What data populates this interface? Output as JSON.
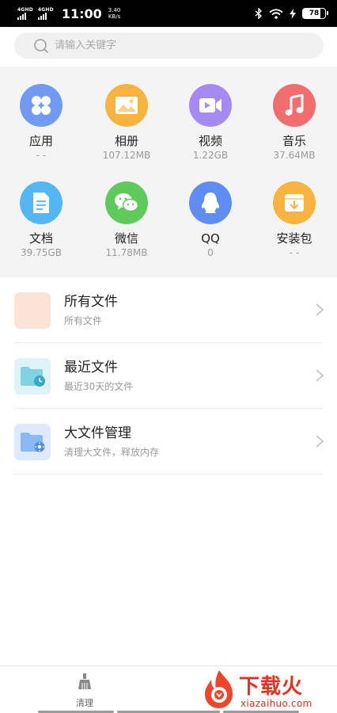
{
  "status_bar": {
    "sim1_tag": "4GHD",
    "sim2_tag": "4GHD",
    "time": "11:00",
    "speed_value": "3.40",
    "speed_unit": "KB/s",
    "battery": "78"
  },
  "search": {
    "placeholder": "请输入关键字"
  },
  "categories": [
    {
      "name": "应用",
      "size": "- -",
      "color": "#6f9cf2",
      "icon": "apps-grid-icon"
    },
    {
      "name": "相册",
      "size": "107.12MB",
      "color": "#f7b33d",
      "icon": "photo-album-icon"
    },
    {
      "name": "视频",
      "size": "1.22GB",
      "color": "#a58bf1",
      "icon": "video-icon"
    },
    {
      "name": "音乐",
      "size": "37.64MB",
      "color": "#f26d6d",
      "icon": "music-note-icon"
    },
    {
      "name": "文档",
      "size": "39.75GB",
      "color": "#52b7f2",
      "icon": "document-icon"
    },
    {
      "name": "微信",
      "size": "11.78MB",
      "color": "#5fca5c",
      "icon": "wechat-icon"
    },
    {
      "name": "QQ",
      "size": "0",
      "color": "#5f8ef2",
      "icon": "qq-penguin-icon"
    },
    {
      "name": "安装包",
      "size": "- -",
      "color": "#f7b33d",
      "icon": "package-icon"
    }
  ],
  "file_list": [
    {
      "title": "所有文件",
      "subtitle": "所有文件",
      "icon": "all-files-icon",
      "icon_bg": "#fbe3d6"
    },
    {
      "title": "最近文件",
      "subtitle": "最近30天的文件",
      "icon": "recent-files-icon",
      "icon_bg": "#def3f7"
    },
    {
      "title": "大文件管理",
      "subtitle": "清理大文件，释放内存",
      "icon": "large-files-icon",
      "icon_bg": "#dceafb"
    }
  ],
  "bottom_nav": {
    "clean_label": "清理"
  },
  "watermark": {
    "title": "下载火",
    "url": "xiazaihuo.com"
  }
}
